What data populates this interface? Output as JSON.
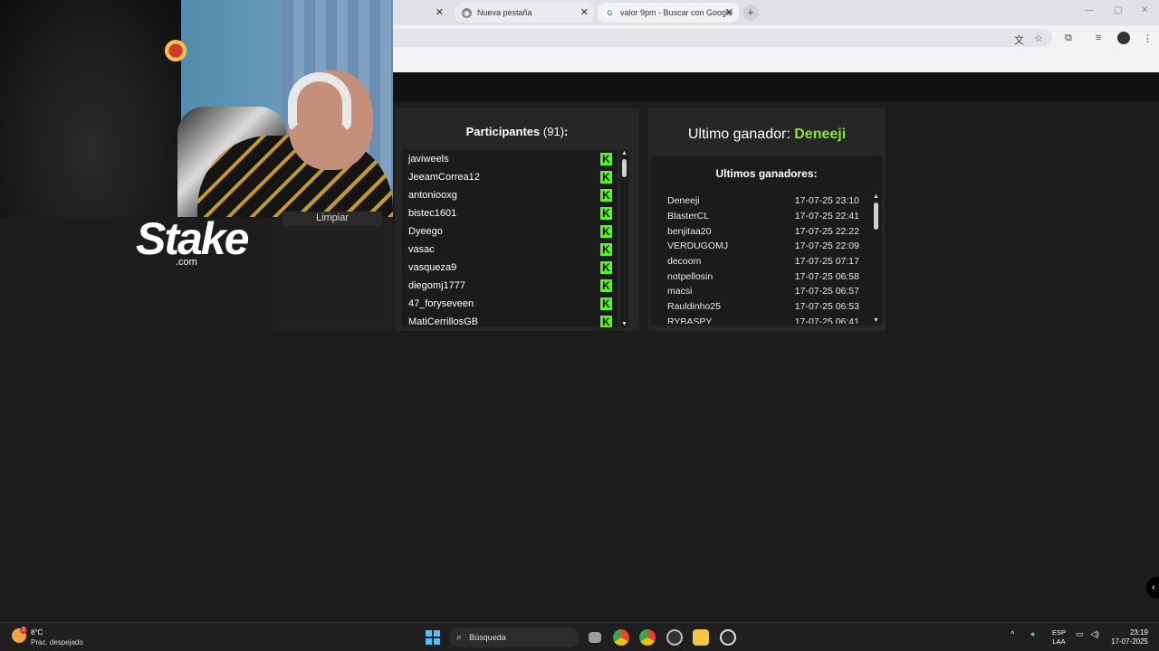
{
  "browser": {
    "tabs": [
      {
        "label": ""
      },
      {
        "label": "Nueva pestaña"
      },
      {
        "label": "valor 9pm - Buscar con Google"
      }
    ],
    "new_tab": "+"
  },
  "overlay": {
    "brand": "Stake",
    "brand_suffix": ".com",
    "clear_label": "Limpiar"
  },
  "participants": {
    "title": "Participantes",
    "count": "(91)",
    "colon": ":",
    "platform_icon": "kick-icon",
    "items": [
      "javiweels",
      "JeeamCorrea12",
      "antoniooxg",
      "bistec1601",
      "Dyeego",
      "vasac",
      "vasqueza9",
      "diegomj1777",
      "47_foryseveen",
      "MatiCerrillosGB"
    ]
  },
  "winners": {
    "title_prefix": "Ultimo ganador:",
    "last_winner": "Deneeji",
    "list_title": "Ultimos ganadores:",
    "items": [
      {
        "name": "Deneeji",
        "date": "17-07-25 23:10"
      },
      {
        "name": "BlasterCL",
        "date": "17-07-25 22:41"
      },
      {
        "name": "benjitaa20",
        "date": "17-07-25 22:22"
      },
      {
        "name": "VERDUGOMJ",
        "date": "17-07-25 22:09"
      },
      {
        "name": "decoom",
        "date": "17-07-25 07:17"
      },
      {
        "name": "notpellosin",
        "date": "17-07-25 06:58"
      },
      {
        "name": "macsi",
        "date": "17-07-25 06:57"
      },
      {
        "name": "Rauldinho25",
        "date": "17-07-25 06:53"
      },
      {
        "name": "RYBASPY",
        "date": "17-07-25 06:41"
      }
    ]
  },
  "taskbar": {
    "temperature": "8°C",
    "weather": "Prac. despejado",
    "weather_badge": "2",
    "search_placeholder": "Búsqueda",
    "lang_line1": "ESP",
    "lang_line2": "LAA",
    "time": "23:19",
    "date": "17-07-2025"
  },
  "colors": {
    "kick_green": "#53fc18",
    "winner_green": "#8de03c",
    "panel_bg": "#262626"
  }
}
